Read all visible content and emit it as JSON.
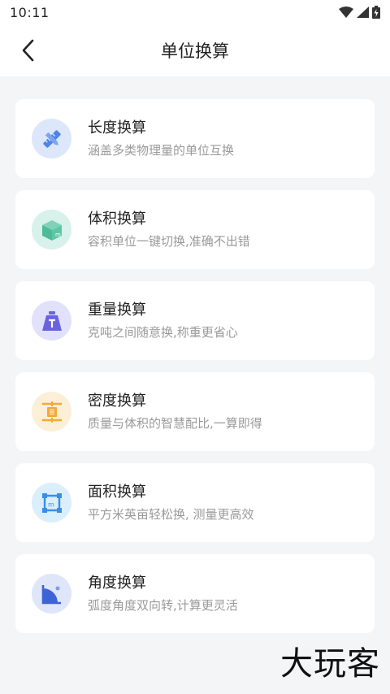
{
  "status_bar": {
    "time": "10:11"
  },
  "header": {
    "title": "单位换算"
  },
  "colors": {
    "length": "#dce7fa",
    "volume": "#d8f1ea",
    "weight": "#e2e1fb",
    "density": "#fcefd8",
    "area": "#dbeefb",
    "angle": "#dfe6fa"
  },
  "items": [
    {
      "title": "长度换算",
      "desc": "涵盖多类物理量的单位互换",
      "icon": "ruler-pencil-icon"
    },
    {
      "title": "体积换算",
      "desc": "容积单位一键切换,准确不出错",
      "icon": "cube-icon"
    },
    {
      "title": "重量换算",
      "desc": "克吨之间随意换,称重更省心",
      "icon": "weight-icon"
    },
    {
      "title": "密度换算",
      "desc": "质量与体积的智慧配比,一算即得",
      "icon": "density-icon"
    },
    {
      "title": "面积换算",
      "desc": "平方米英亩轻松换, 测量更高效",
      "icon": "area-square-icon"
    },
    {
      "title": "角度换算",
      "desc": "弧度角度双向转,计算更灵活",
      "icon": "angle-icon"
    }
  ],
  "watermark": "大玩客"
}
